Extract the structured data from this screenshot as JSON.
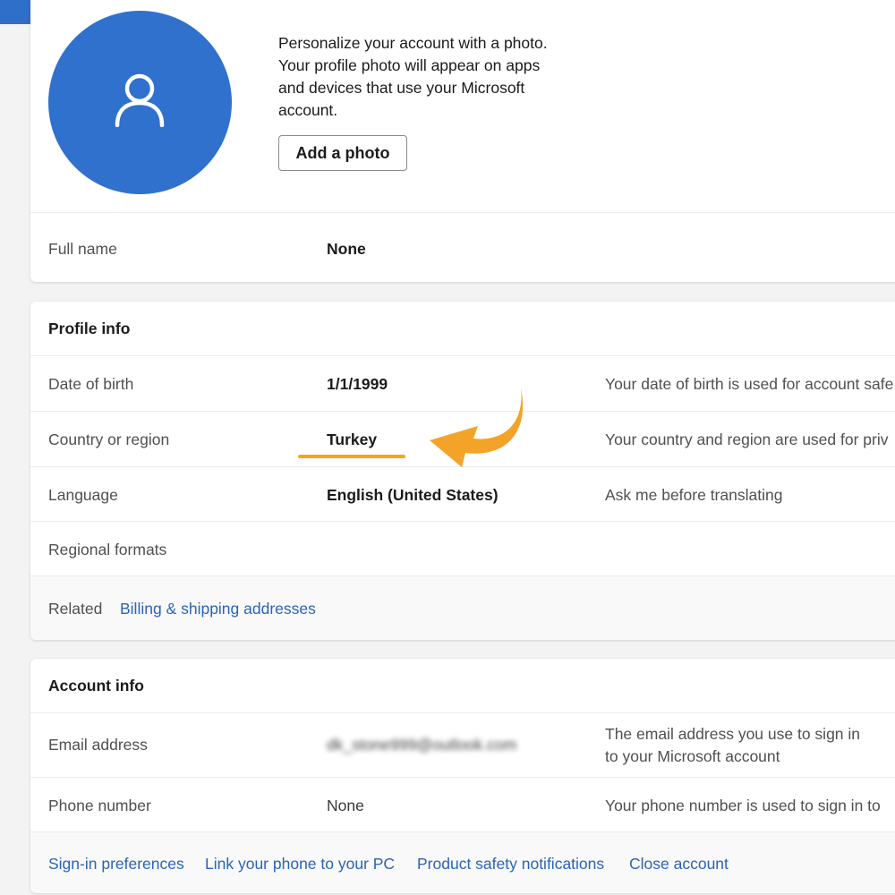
{
  "colors": {
    "topbar": "#2f6fca",
    "avatar": "#2f71cc",
    "link": "#2a64b8",
    "accent_arrow": "#f3a428"
  },
  "photo": {
    "icon": "person-icon",
    "text": "Personalize your account with a photo. Your profile photo will appear on apps and devices that use your Microsoft account.",
    "button_label": "Add a photo"
  },
  "full_name": {
    "label": "Full name",
    "value": "None"
  },
  "profile_info": {
    "heading": "Profile info",
    "rows": [
      {
        "label": "Date of birth",
        "value": "1/1/1999",
        "desc": "Your date of birth is used for account safe"
      },
      {
        "label": "Country or region",
        "value": "Turkey",
        "desc": "Your country and region are used for priv"
      },
      {
        "label": "Language",
        "value": "English (United States)",
        "desc": "Ask me before translating"
      },
      {
        "label": "Regional formats",
        "value": "",
        "desc": ""
      }
    ],
    "related_label": "Related",
    "related_link": "Billing & shipping addresses"
  },
  "account_info": {
    "heading": "Account info",
    "email": {
      "label": "Email address",
      "value": "dk_stone999@outlook.com",
      "desc_line1": "The email address you use to sign in",
      "desc_line2": "to your Microsoft account"
    },
    "phone": {
      "label": "Phone number",
      "value": "None",
      "desc": "Your phone number is used to sign in to"
    },
    "footer_links": [
      "Sign-in preferences",
      "Link your phone to your PC",
      "Product safety notifications",
      "Close account"
    ]
  }
}
